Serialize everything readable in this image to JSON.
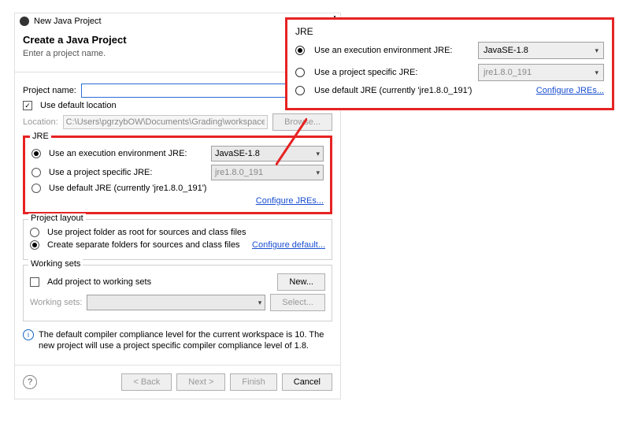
{
  "dialog": {
    "windowTitle": "New Java Project",
    "heading": "Create a Java Project",
    "subheading": "Enter a project name.",
    "projectNameLabel": "Project name:",
    "projectNameValue": "",
    "useDefaultLocationLabel": "Use default location",
    "locationLabel": "Location:",
    "locationValue": "C:\\Users\\pgrzybOW\\Documents\\Grading\\workspace",
    "browseLabel": "Browse..."
  },
  "jre": {
    "legend": "JRE",
    "opt1Label": "Use an execution environment JRE:",
    "opt1Value": "JavaSE-1.8",
    "opt2Label": "Use a project specific JRE:",
    "opt2Value": "jre1.8.0_191",
    "opt3Label": "Use default JRE (currently 'jre1.8.0_191')",
    "configureLink": "Configure JREs..."
  },
  "layout": {
    "legend": "Project layout",
    "opt1": "Use project folder as root for sources and class files",
    "opt2": "Create separate folders for sources and class files",
    "configureLink": "Configure default..."
  },
  "workingSets": {
    "legend": "Working sets",
    "addLabel": "Add project to working sets",
    "newLabel": "New...",
    "wsLabel": "Working sets:",
    "selectLabel": "Select..."
  },
  "info": {
    "text": "The default compiler compliance level for the current workspace is 10. The new project will use a project specific compiler compliance level of 1.8."
  },
  "buttons": {
    "back": "< Back",
    "next": "Next >",
    "finish": "Finish",
    "cancel": "Cancel"
  }
}
